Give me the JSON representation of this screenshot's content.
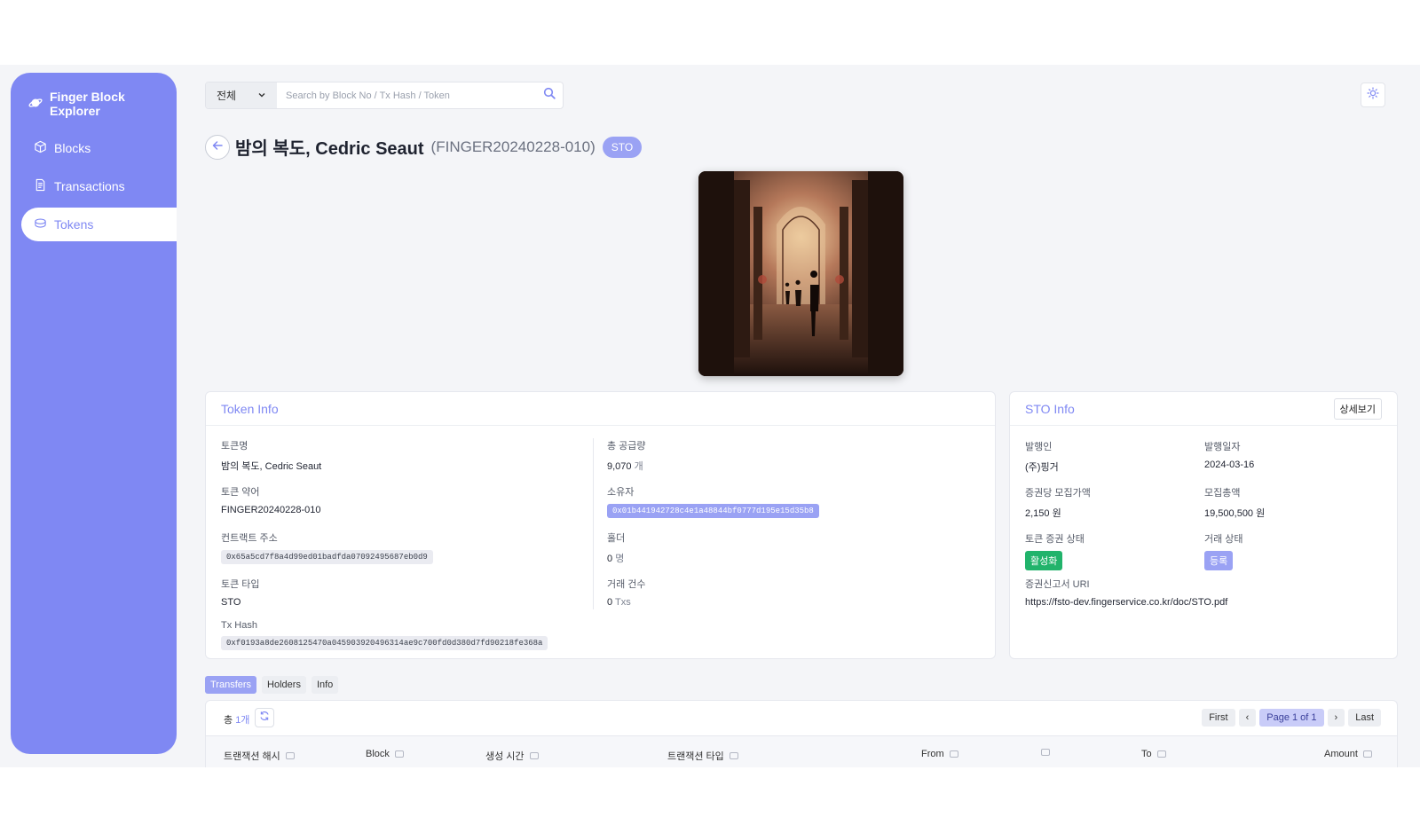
{
  "sidebar": {
    "brand": "Finger Block Explorer",
    "items": [
      {
        "label": "Blocks",
        "icon": "cube-icon"
      },
      {
        "label": "Transactions",
        "icon": "document-icon"
      },
      {
        "label": "Tokens",
        "icon": "coins-icon",
        "active": true
      }
    ]
  },
  "search": {
    "scope": "전체",
    "placeholder": "Search by Block No / Tx Hash / Token"
  },
  "token": {
    "name": "밤의 복도, Cedric Seaut",
    "symbol_display": "(FINGER20240228-010)",
    "type_badge": "STO"
  },
  "token_info": {
    "title": "Token Info",
    "name_label": "토큰명",
    "name_value": "밤의 복도, Cedric Seaut",
    "symbol_label": "토큰 약어",
    "symbol_value": "FINGER20240228-010",
    "contract_label": "컨트랙트 주소",
    "contract_value": "0x65a5cd7f8a4d99ed01badfda07092495687eb0d9",
    "type_label": "토큰 타입",
    "type_value": "STO",
    "txhash_label": "Tx Hash",
    "txhash_value": "0xf0193a8de2608125470a045903920496314ae9c700fd0d380d7fd90218fe368a",
    "supply_label": "총 공급량",
    "supply_value": "9,070",
    "supply_unit": "개",
    "owner_label": "소유자",
    "owner_value": "0x01b441942728c4e1a48844bf0777d195e15d35b8",
    "holders_label": "홀더",
    "holders_value": "0",
    "holders_unit": "명",
    "txcount_label": "거래 건수",
    "txcount_value": "0",
    "txcount_unit": "Txs"
  },
  "sto_info": {
    "title": "STO Info",
    "detail_button": "상세보기",
    "issuer_label": "발행인",
    "issuer_value": "(주)핑거",
    "issue_date_label": "발행일자",
    "issue_date_value": "2024-03-16",
    "price_label": "증권당 모집가액",
    "price_value": "2,150 원",
    "total_label": "모집총액",
    "total_value": "19,500,500 원",
    "status_label": "토큰 증권 상태",
    "status_value": "활성화",
    "trade_status_label": "거래 상태",
    "trade_status_value": "등록",
    "uri_label": "증권신고서 URI",
    "uri_value": "https://fsto-dev.fingerservice.co.kr/doc/STO.pdf",
    "status_color": "#21b36b",
    "trade_status_color": "#9aa2f4"
  },
  "tabs": [
    "Transfers",
    "Holders",
    "Info"
  ],
  "table": {
    "total_prefix": "총",
    "total_count": "1개",
    "pager": {
      "first": "First",
      "prev": "‹",
      "current": "Page 1 of 1",
      "next": "›",
      "last": "Last"
    },
    "headers": [
      "트랜잭션 해시",
      "Block",
      "생성 시간",
      "트랜잭션 타입",
      "From",
      "",
      "To",
      "Amount"
    ]
  },
  "colors": {
    "accent": "#7f88f3",
    "accent_light": "#9aa2f4"
  }
}
